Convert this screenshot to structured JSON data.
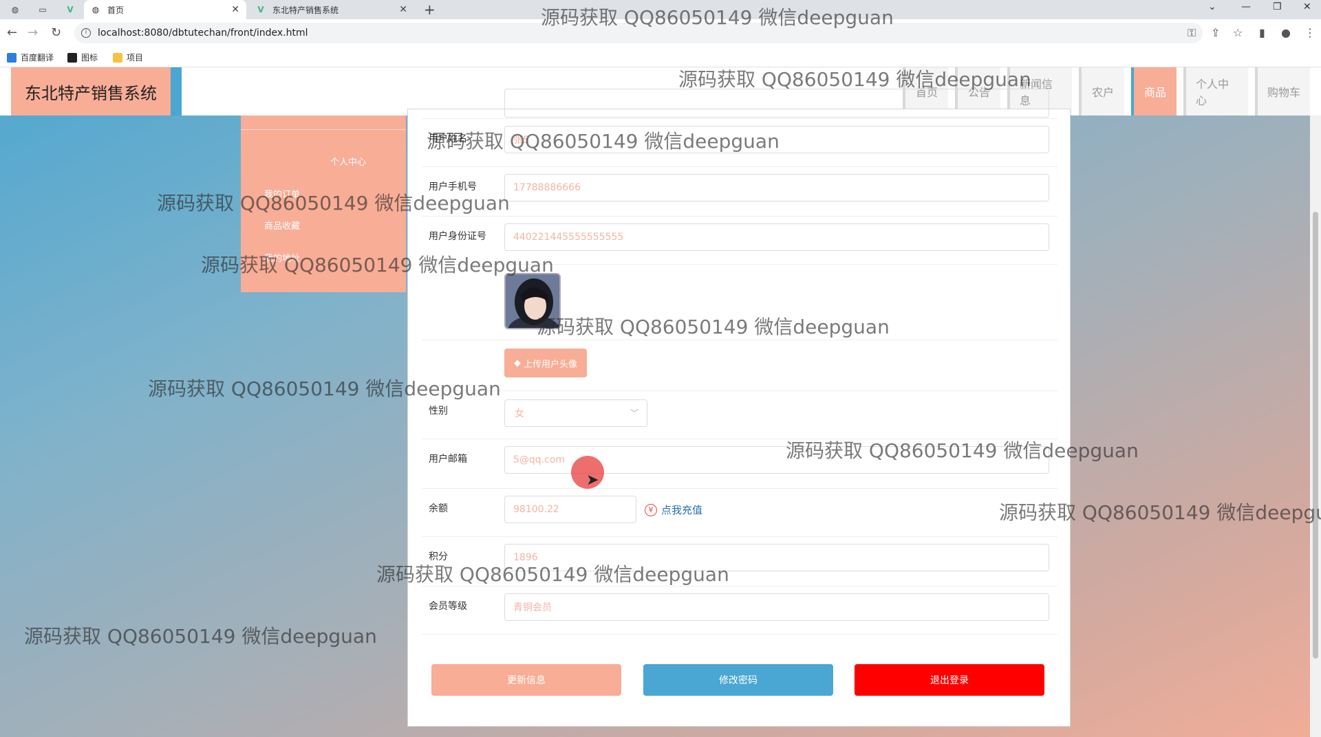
{
  "browser": {
    "tabs": [
      {
        "title": "首页",
        "active": true
      },
      {
        "title": "东北特产销售系统",
        "active": false
      }
    ],
    "url": "localhost:8080/dbtutechan/front/index.html",
    "bookmarks": [
      "百度翻译",
      "图标",
      "项目"
    ]
  },
  "site": {
    "logo_text": "东北特产销售系统",
    "nav": [
      "首页",
      "公告",
      "新闻信息",
      "农户",
      "商品",
      "个人中心",
      "购物车"
    ],
    "active_nav": "商品",
    "sidebar": [
      "个人中心",
      "我的订单",
      "商品收藏",
      "我的地址"
    ]
  },
  "form": {
    "name": {
      "label": "用户姓名",
      "value": "张5"
    },
    "phone": {
      "label": "用户手机号",
      "value": "17788886666"
    },
    "idcard": {
      "label": "用户身份证号",
      "value": "440221445555555555"
    },
    "upload_label": "上传用户头像",
    "gender": {
      "label": "性别",
      "value": "女"
    },
    "email": {
      "label": "用户邮箱",
      "value": "5@qq.com"
    },
    "balance": {
      "label": "余额",
      "value": "98100.22",
      "recharge": "点我充值"
    },
    "points": {
      "label": "积分",
      "value": "1896"
    },
    "level": {
      "label": "会员等级",
      "value": "青铜会员"
    }
  },
  "buttons": {
    "update": "更新信息",
    "change_password": "修改密码",
    "logout": "退出登录"
  },
  "colors": {
    "primary": "#f8ad96",
    "accent": "#4aa6d3",
    "danger": "#ff0000"
  },
  "watermark": "源码获取 QQ86050149 微信deepguan"
}
